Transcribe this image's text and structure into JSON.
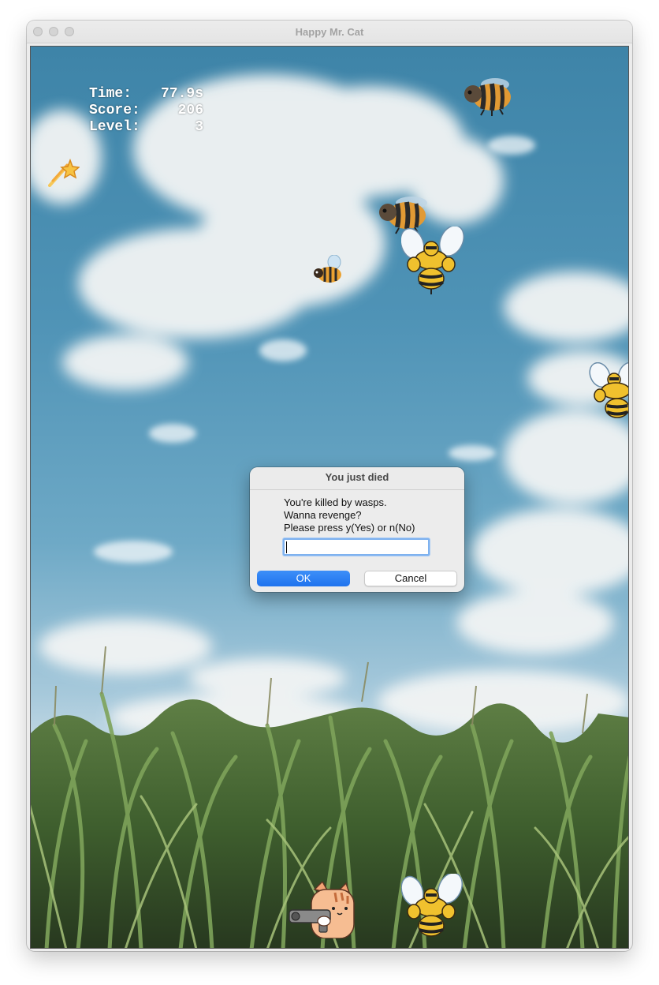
{
  "window": {
    "title": "Happy Mr. Cat"
  },
  "hud": {
    "time_label": "Time:",
    "time_value": "77.9s",
    "score_label": "Score:",
    "score_value": "206",
    "level_label": "Level:",
    "level_value": "3"
  },
  "dialog": {
    "title": "You just died",
    "lines": [
      "You're killed by wasps.",
      "Wanna revenge?",
      "Please press y(Yes) or n(No)"
    ],
    "input_value": "",
    "ok_label": "OK",
    "cancel_label": "Cancel"
  },
  "sprites": {
    "powerup": "shooting-star-icon",
    "bees": [
      "bee-icon",
      "bee-icon",
      "small-bee-icon"
    ],
    "wasps": [
      "muscle-wasp-icon",
      "muscle-wasp-icon",
      "muscle-wasp-icon"
    ],
    "player": "cat-with-gun-icon"
  }
}
